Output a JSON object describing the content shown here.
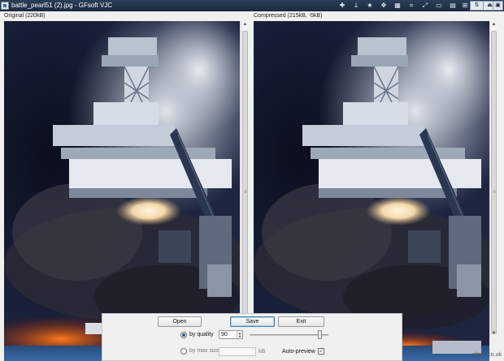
{
  "window": {
    "title": "battle_pearl51 (2).jpg - GFsoft VJC",
    "toolbar_icons": [
      "pin-icon",
      "collapse-icon",
      "favorite-star-icon",
      "move-icon",
      "grid-icon",
      "crop-icon",
      "expand-icon",
      "window-icon",
      "layout-icon",
      "fit-icon",
      "sort-icon",
      "eject-icon",
      "image-icon"
    ]
  },
  "panes": {
    "original_label": "Original (220kB)",
    "compressed_label": "Compressed (215kB, -5kB)"
  },
  "controls": {
    "open_label": "Open",
    "save_label": "Save",
    "exit_label": "Exit",
    "by_quality_label": "by quality",
    "quality_value": "90",
    "by_max_size_label": "by max size",
    "max_size_value": "",
    "kb_unit": "kB",
    "auto_preview_label": "Auto-preview",
    "auto_preview_checked": true,
    "quality_slider_level": 0.9
  },
  "footer": {
    "credit": "gfsoft.co.uk"
  }
}
